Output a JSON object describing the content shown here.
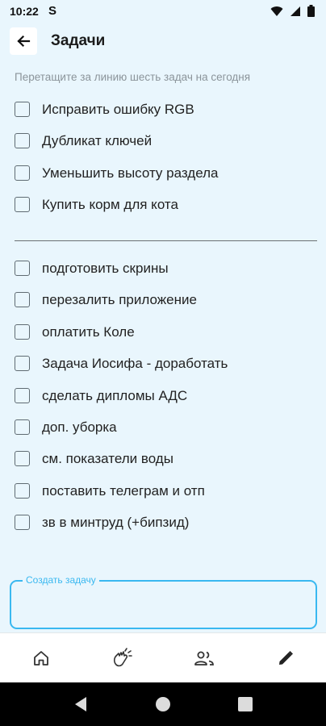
{
  "status_bar": {
    "time": "10:22",
    "notification_glyph": "S",
    "icons": [
      "wifi-icon",
      "signal-icon",
      "battery-icon"
    ]
  },
  "app_bar": {
    "title": "Задачи",
    "back_icon": "arrow-left-icon"
  },
  "hint": "Перетащите за линию шесть задач на сегодня",
  "today_tasks": [
    {
      "label": "Исправить ошибку RGB",
      "checked": false
    },
    {
      "label": "Дубликат ключей",
      "checked": false
    },
    {
      "label": "Уменьшить высоту раздела",
      "checked": false
    },
    {
      "label": "Купить корм для кота",
      "checked": false
    }
  ],
  "other_tasks": [
    {
      "label": "подготовить скрины",
      "checked": false
    },
    {
      "label": "перезалить приложение",
      "checked": false
    },
    {
      "label": "оплатить Коле",
      "checked": false
    },
    {
      "label": "Задача Иосифа - доработать",
      "checked": false
    },
    {
      "label": "сделать дипломы АДС",
      "checked": false
    },
    {
      "label": "доп. уборка",
      "checked": false
    },
    {
      "label": "см. показатели воды",
      "checked": false
    },
    {
      "label": "поставить телеграм и отп",
      "checked": false
    },
    {
      "label": "зв в минтруд (+бипзид)",
      "checked": false
    }
  ],
  "new_task": {
    "label": "Создать задачу",
    "value": ""
  },
  "bottom_nav": [
    "home-icon",
    "hands-icon",
    "people-icon",
    "pencil-icon"
  ],
  "colors": {
    "background": "#e9f6fd",
    "accent": "#39b8f0",
    "text": "#222222"
  }
}
